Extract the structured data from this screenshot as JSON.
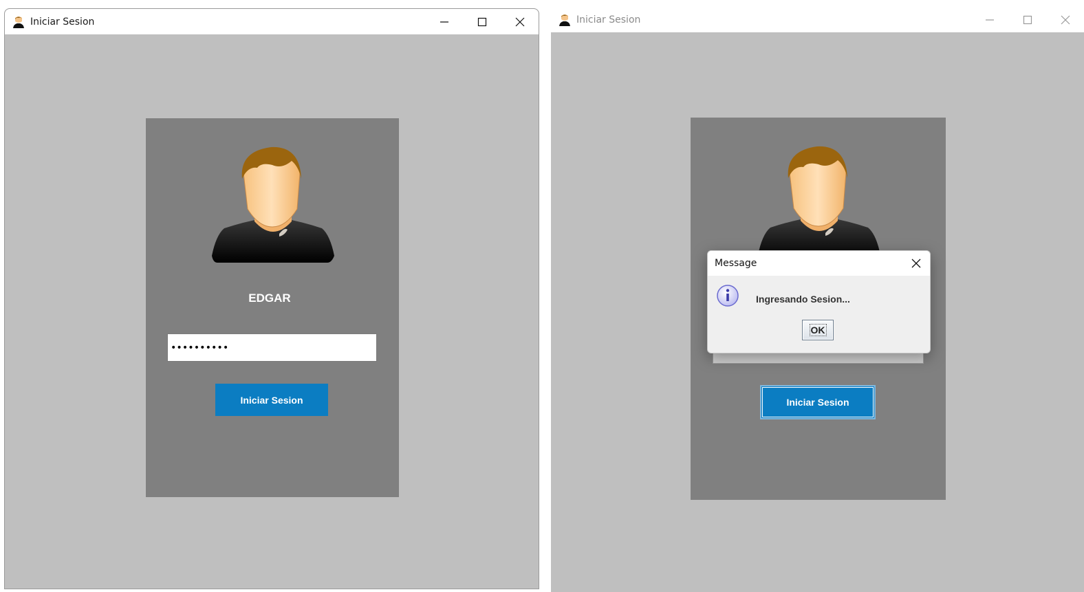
{
  "left_window": {
    "title": "Iniciar Sesion",
    "username": "EDGAR",
    "password_masked": "••••••••••",
    "login_button": "Iniciar Sesion"
  },
  "right_window": {
    "title": "Iniciar Sesion",
    "login_button": "Iniciar Sesion",
    "dialog": {
      "title": "Message",
      "message": "Ingresando Sesion...",
      "ok_label": "OK"
    }
  },
  "icons": {
    "app": "user-icon",
    "minimize": "minimize-icon",
    "maximize": "maximize-icon",
    "close": "close-icon",
    "info": "info-icon"
  },
  "colors": {
    "window_background": "#bfbfbf",
    "panel_background": "#808080",
    "button_blue": "#0b7dc2"
  }
}
